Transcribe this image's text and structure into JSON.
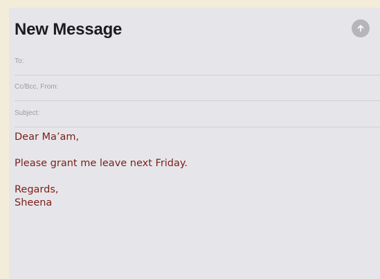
{
  "compose": {
    "title": "New Message",
    "send_icon": "arrow-up-icon",
    "fields": {
      "to_label": "To:",
      "cc_from_label": "Cc/Bcc, From:",
      "subject_label": "Subject:"
    },
    "body": {
      "greeting": "Dear Ma’am,",
      "line": "Please grant me leave next Friday.",
      "closing": "Regards,",
      "signature": "Sheena"
    }
  },
  "colors": {
    "background": "#f3ecd9",
    "panel": "#e6e6ea",
    "body_text": "#7a1d18"
  }
}
